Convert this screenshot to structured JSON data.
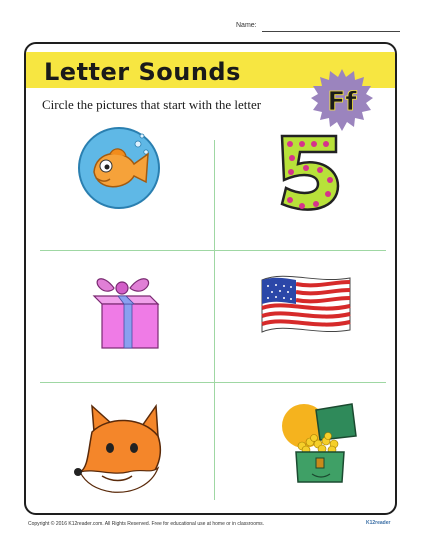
{
  "header": {
    "name_label": "Name:"
  },
  "worksheet": {
    "title": "Letter Sounds",
    "instructions": "Circle the pictures that start with the letter",
    "letter": "Ff"
  },
  "pictures": [
    {
      "name": "fish"
    },
    {
      "name": "five"
    },
    {
      "name": "gift"
    },
    {
      "name": "flag"
    },
    {
      "name": "fox"
    },
    {
      "name": "treasure chest"
    }
  ],
  "footer": {
    "copyright": "Copyright © 2016 K12reader.com. All Rights Reserved. Free for educational use at home or in classrooms.",
    "brand": "K12reader"
  },
  "colors": {
    "banner": "#f7e641",
    "badge": "#9b84be",
    "divider": "#9fd7a3"
  }
}
